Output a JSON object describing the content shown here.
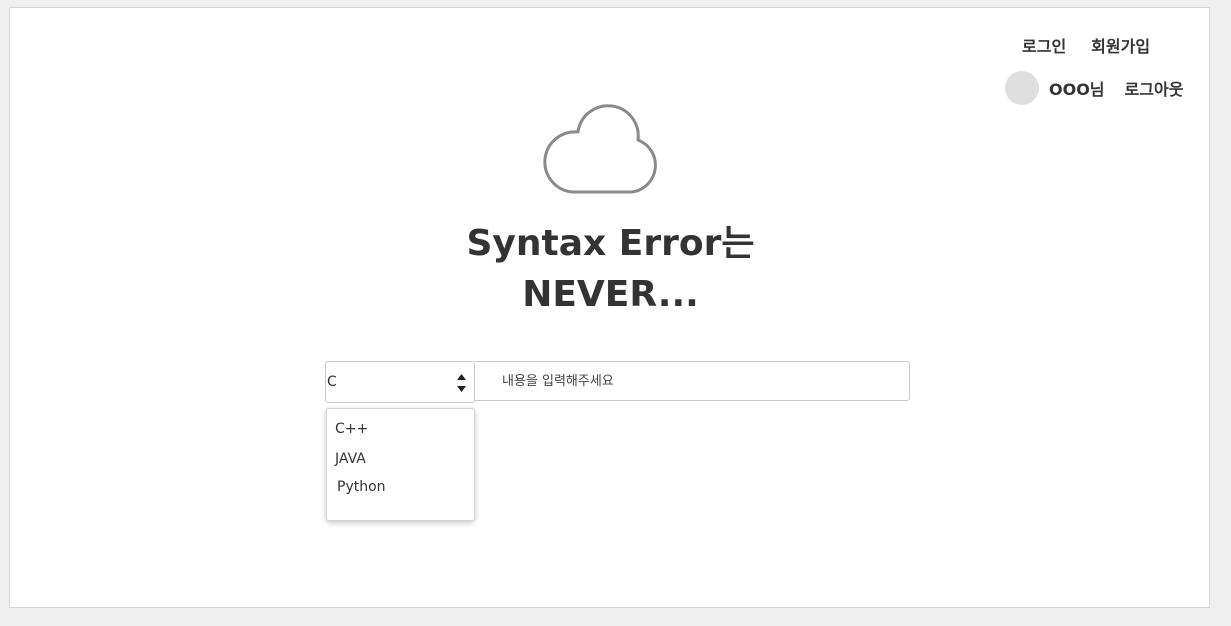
{
  "header": {
    "login_label": "로그인",
    "signup_label": "회원가입",
    "username": "OOO님",
    "logout_label": "로그아웃"
  },
  "hero": {
    "icon": "cloud-icon",
    "title_line1": "Syntax Error는",
    "title_line2": "NEVER..."
  },
  "search": {
    "language_selected": "C",
    "input_placeholder": "내용을 입력해주세요",
    "input_value": ""
  },
  "language_dropdown": {
    "items": [
      "C++",
      "JAVA",
      "Python"
    ]
  }
}
